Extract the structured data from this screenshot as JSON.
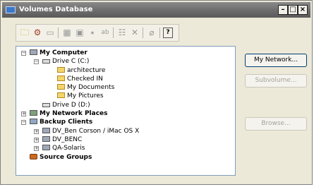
{
  "window": {
    "title": "Volumes Database",
    "minimize": "–",
    "maximize": "□",
    "close": "×"
  },
  "toolbar": {
    "buttons": [
      {
        "icon": "open-folder-icon",
        "glyph": "🗀",
        "enabled": true
      },
      {
        "icon": "new-item-icon",
        "glyph": "⚙",
        "enabled": true
      },
      {
        "icon": "folder-icon",
        "glyph": "▭",
        "enabled": false
      },
      {
        "icon": "properties-icon",
        "glyph": "▦",
        "enabled": false
      },
      {
        "icon": "share-icon",
        "glyph": "▣",
        "enabled": false
      },
      {
        "icon": "link-icon",
        "glyph": "⭑",
        "enabled": false
      },
      {
        "icon": "rename-icon",
        "glyph": "ab",
        "enabled": false
      },
      {
        "icon": "comment-icon",
        "glyph": "☷",
        "enabled": false
      },
      {
        "icon": "delete-icon",
        "glyph": "✕",
        "enabled": false
      },
      {
        "icon": "erase-icon",
        "glyph": "⌀",
        "enabled": false
      },
      {
        "icon": "help-icon",
        "glyph": "?",
        "enabled": true
      }
    ]
  },
  "tree": {
    "my_computer": "My Computer",
    "drive_c": "Drive C (C:)",
    "folder_architecture": "architecture",
    "folder_checked_in": "Checked IN",
    "folder_my_documents": "My Documents",
    "folder_my_pictures": "My Pictures",
    "drive_d": "Drive D (D:)",
    "my_network_places": "My Network Places",
    "backup_clients": "Backup Clients",
    "client_1": "DV_Ben Corson / iMac OS X",
    "client_2": "DV_BENC",
    "client_3": "QA-Solaris",
    "source_groups": "Source Groups",
    "expander_open": "−",
    "expander_closed": "+"
  },
  "buttons": {
    "my_network": "My Network...",
    "subvolume": "Subvolume...",
    "browse": "Browse..."
  }
}
